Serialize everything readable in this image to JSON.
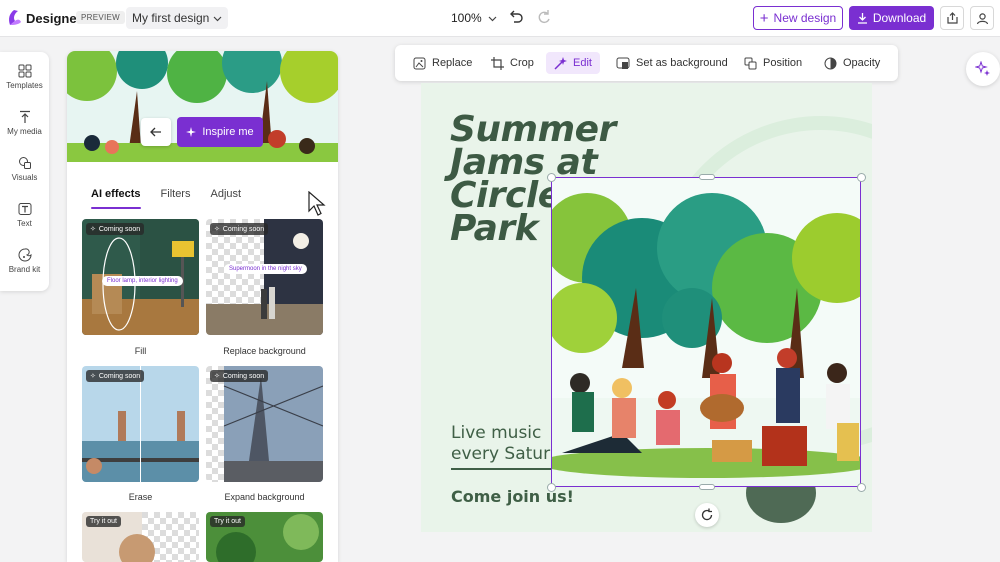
{
  "app": {
    "name": "Designer",
    "badge": "PREVIEW",
    "design_name": "My first design"
  },
  "header": {
    "zoom": "100%",
    "new_design_label": "New design",
    "download_label": "Download"
  },
  "rail": {
    "items": [
      {
        "label": "Templates",
        "icon": "templates-icon"
      },
      {
        "label": "My media",
        "icon": "upload-icon"
      },
      {
        "label": "Visuals",
        "icon": "visuals-icon"
      },
      {
        "label": "Text",
        "icon": "text-icon"
      },
      {
        "label": "Brand kit",
        "icon": "brand-kit-icon"
      }
    ]
  },
  "panel": {
    "inspire_label": "Inspire me",
    "tabs": [
      "AI effects",
      "Filters",
      "Adjust"
    ],
    "cards": [
      {
        "label": "Fill",
        "badge": "Coming soon",
        "prompt": "Floor lamp, interior lighting"
      },
      {
        "label": "Replace background",
        "badge": "Coming soon",
        "prompt": "Supermoon in the night sky"
      },
      {
        "label": "Erase",
        "badge": "Coming soon"
      },
      {
        "label": "Expand background",
        "badge": "Coming soon"
      },
      {
        "badge": "Try it out"
      },
      {
        "badge": "Try it out"
      }
    ]
  },
  "toolbar": {
    "items": [
      "Replace",
      "Crop",
      "Edit",
      "Set as background",
      "Position",
      "Opacity"
    ],
    "active": "Edit"
  },
  "canvas": {
    "headline": [
      "Summer",
      "Jams at",
      "Circle",
      "Park"
    ],
    "line1": "Live music",
    "line2": "every Satur",
    "cta": "Come join us!"
  },
  "colors": {
    "accent": "#7a2fd1",
    "canvas_bg": "#e9f4ea",
    "headline": "#3d5a44"
  }
}
